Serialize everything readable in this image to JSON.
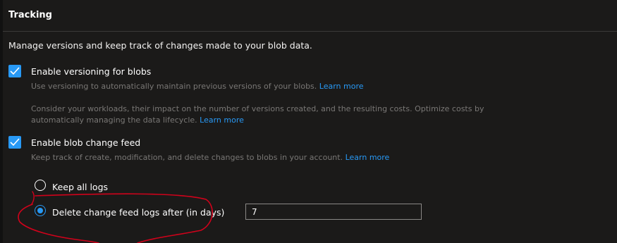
{
  "section": {
    "title": "Tracking",
    "description": "Manage versions and keep track of changes made to your blob data."
  },
  "versioning": {
    "label": "Enable versioning for blobs",
    "checked": true,
    "help1": "Use versioning to automatically maintain previous versions of your blobs.",
    "help1_link": "Learn more",
    "help2": "Consider your workloads, their impact on the number of versions created, and the resulting costs. Optimize costs by automatically managing the data lifecycle.",
    "help2_link": "Learn more"
  },
  "change_feed": {
    "label": "Enable blob change feed",
    "checked": true,
    "help": "Keep track of create, modification, and delete changes to blobs in your account.",
    "help_link": "Learn more"
  },
  "retention": {
    "options": [
      {
        "label": "Keep all logs",
        "selected": false
      },
      {
        "label": "Delete change feed logs after (in days)",
        "selected": true
      }
    ],
    "days_value": "7"
  },
  "colors": {
    "accent": "#2899f5",
    "annotation": "#d0021b"
  },
  "icons": {
    "checkbox": "checkmark-icon",
    "annotation": "freehand-circle-annotation"
  }
}
